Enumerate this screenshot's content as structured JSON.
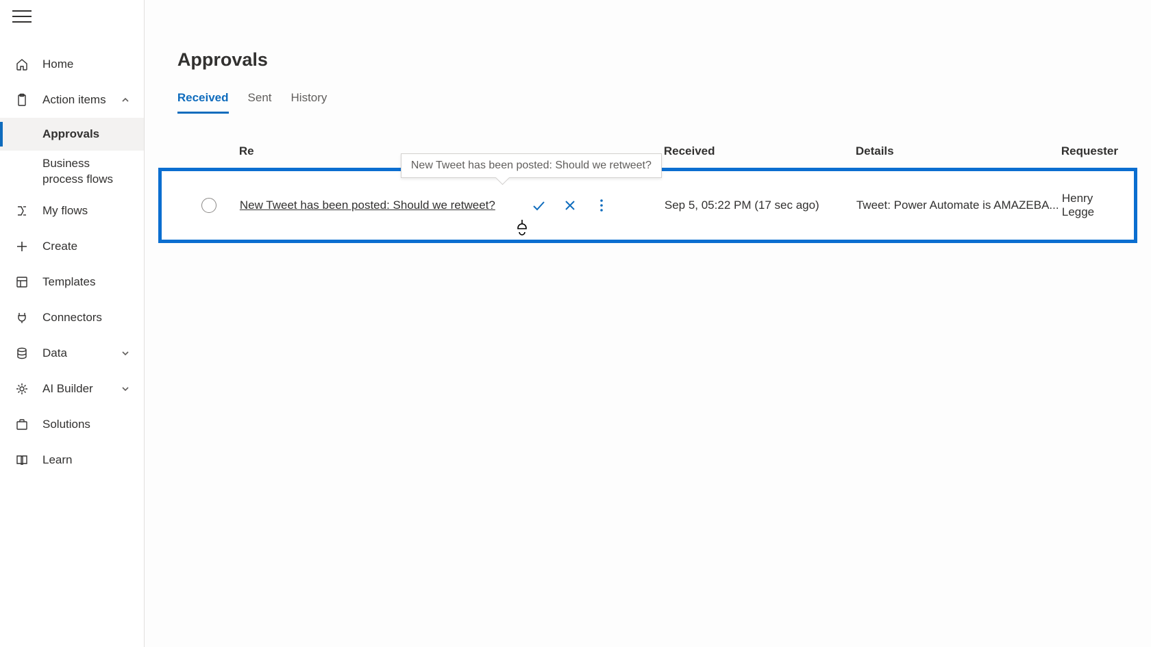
{
  "sidebar": {
    "items": [
      {
        "label": "Home"
      },
      {
        "label": "Action items"
      },
      {
        "label": "Approvals"
      },
      {
        "label": "Business process flows"
      },
      {
        "label": "My flows"
      },
      {
        "label": "Create"
      },
      {
        "label": "Templates"
      },
      {
        "label": "Connectors"
      },
      {
        "label": "Data"
      },
      {
        "label": "AI Builder"
      },
      {
        "label": "Solutions"
      },
      {
        "label": "Learn"
      }
    ]
  },
  "page": {
    "title": "Approvals",
    "tabs": [
      {
        "label": "Received"
      },
      {
        "label": "Sent"
      },
      {
        "label": "History"
      }
    ],
    "columns": {
      "request": "Re",
      "received": "Received",
      "details": "Details",
      "requester": "Requester"
    },
    "rows": [
      {
        "title": "New Tweet has been posted: Should we retweet?",
        "received": "Sep 5, 05:22 PM (17 sec ago)",
        "details": "Tweet: Power Automate is AMAZEBA...",
        "requester": "Henry Legge"
      }
    ],
    "tooltip": "New Tweet has been posted: Should we retweet?"
  }
}
